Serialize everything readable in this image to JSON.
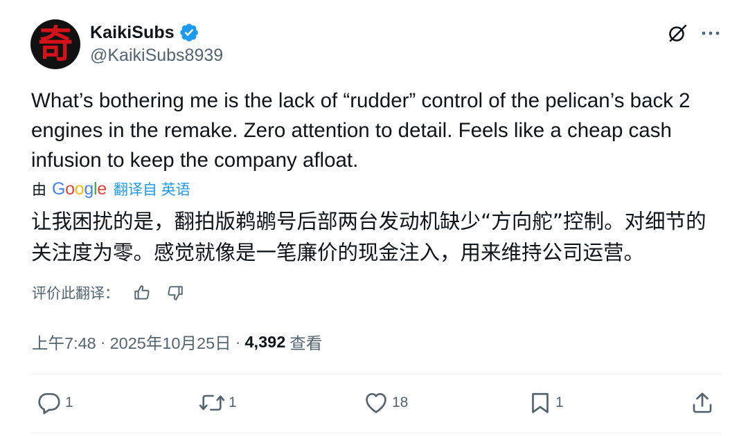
{
  "author": {
    "avatar_glyph": "奇",
    "display_name": "KaikiSubs",
    "handle": "@KaikiSubs8939",
    "verified": true
  },
  "header_icons": [
    "grok-icon",
    "more-icon"
  ],
  "tweet": {
    "text": "What’s bothering me is the lack of “rudder” control of the pelican’s back 2 engines in the remake. Zero attention to detail. Feels like a cheap cash infusion to keep the company afloat."
  },
  "translation": {
    "by_label": "由",
    "provider_letters": [
      "G",
      "o",
      "o",
      "g",
      "l",
      "e"
    ],
    "link_label": "翻译自 英语",
    "text": "让我困扰的是，翻拍版鹈鹕号后部两台发动机缺少“方向舵”控制。对细节的关注度为零。感觉就像是一笔廉价的现金注入，用来维持公司运营。",
    "rate_label": "评价此翻译："
  },
  "meta": {
    "time": "上午7:48",
    "sep1": "·",
    "date": "2025年10月25日",
    "sep2": "·",
    "views_count": "4,392",
    "views_label": "查看"
  },
  "actions": {
    "reply_count": "1",
    "repost_count": "1",
    "like_count": "18",
    "bookmark_count": "1"
  },
  "colors": {
    "text": "#0f1419",
    "secondary": "#536471",
    "link": "#1d9bf0",
    "verified": "#1d9bf0",
    "avatar_bg": "#111111",
    "avatar_glyph": "#d4121a"
  }
}
